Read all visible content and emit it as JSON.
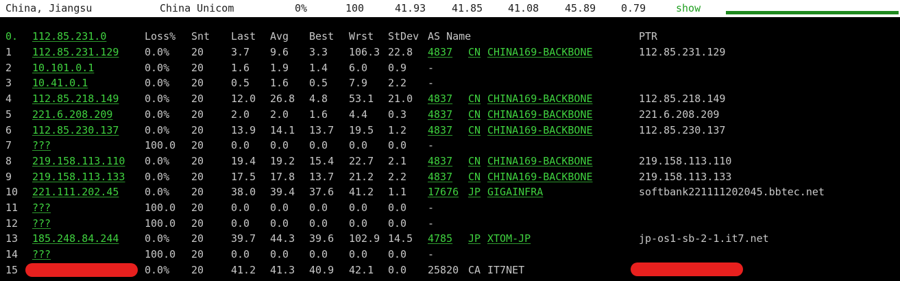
{
  "summary": {
    "location": "China, Jiangsu",
    "isp": "China Unicom",
    "loss": "0%",
    "sent": "100",
    "last": "41.93",
    "avg": "41.85",
    "best": "41.08",
    "worst": "45.89",
    "stdev": "0.79",
    "toggle": "show",
    "accent_color": "#1f8a1f"
  },
  "table": {
    "dest_prefix": "0.",
    "dest_host": "112.85.231.0",
    "headers": {
      "loss": "Loss%",
      "snt": "Snt",
      "last": "Last",
      "avg": "Avg",
      "best": "Best",
      "wrst": "Wrst",
      "stdev": "StDev",
      "as_name": "AS Name",
      "ptr": "PTR"
    },
    "hops": [
      {
        "n": "1",
        "host": "112.85.231.129",
        "loss": "0.0%",
        "snt": "20",
        "last": "3.7",
        "avg": "9.6",
        "best": "3.3",
        "wrst": "106.3",
        "stdev": "22.8",
        "asn": "4837 ",
        "cc": "CN",
        "asname": "CHINA169-BACKBONE",
        "ptr": "112.85.231.129"
      },
      {
        "n": "2",
        "host": "10.101.0.1",
        "loss": "0.0%",
        "snt": "20",
        "last": "1.6",
        "avg": "1.9",
        "best": "1.4",
        "wrst": "6.0",
        "stdev": "0.9",
        "asn": "-",
        "cc": "",
        "asname": "",
        "ptr": ""
      },
      {
        "n": "3",
        "host": "10.41.0.1",
        "loss": "0.0%",
        "snt": "20",
        "last": "0.5",
        "avg": "1.6",
        "best": "0.5",
        "wrst": "7.9",
        "stdev": "2.2",
        "asn": "-",
        "cc": "",
        "asname": "",
        "ptr": ""
      },
      {
        "n": "4",
        "host": "112.85.218.149",
        "loss": "0.0%",
        "snt": "20",
        "last": "12.0",
        "avg": "26.8",
        "best": "4.8",
        "wrst": "53.1",
        "stdev": "21.0",
        "asn": "4837 ",
        "cc": "CN",
        "asname": "CHINA169-BACKBONE",
        "ptr": "112.85.218.149"
      },
      {
        "n": "5",
        "host": "221.6.208.209",
        "loss": "0.0%",
        "snt": "20",
        "last": "2.0",
        "avg": "2.0",
        "best": "1.6",
        "wrst": "4.4",
        "stdev": "0.3",
        "asn": "4837 ",
        "cc": "CN",
        "asname": "CHINA169-BACKBONE",
        "ptr": "221.6.208.209"
      },
      {
        "n": "6",
        "host": "112.85.230.137",
        "loss": "0.0%",
        "snt": "20",
        "last": "13.9",
        "avg": "14.1",
        "best": "13.7",
        "wrst": "19.5",
        "stdev": "1.2",
        "asn": "4837 ",
        "cc": "CN",
        "asname": "CHINA169-BACKBONE",
        "ptr": "112.85.230.137"
      },
      {
        "n": "7",
        "host": "???",
        "loss": "100.0",
        "snt": "20",
        "last": "0.0",
        "avg": "0.0",
        "best": "0.0",
        "wrst": "0.0",
        "stdev": "0.0",
        "asn": "-",
        "cc": "",
        "asname": "",
        "ptr": ""
      },
      {
        "n": "8",
        "host": "219.158.113.110",
        "loss": "0.0%",
        "snt": "20",
        "last": "19.4",
        "avg": "19.2",
        "best": "15.4",
        "wrst": "22.7",
        "stdev": "2.1",
        "asn": "4837 ",
        "cc": "CN",
        "asname": "CHINA169-BACKBONE",
        "ptr": "219.158.113.110"
      },
      {
        "n": "9",
        "host": "219.158.113.133",
        "loss": "0.0%",
        "snt": "20",
        "last": "17.5",
        "avg": "17.8",
        "best": "13.7",
        "wrst": "21.2",
        "stdev": "2.2",
        "asn": "4837 ",
        "cc": "CN",
        "asname": "CHINA169-BACKBONE",
        "ptr": "219.158.113.133"
      },
      {
        "n": "10",
        "host": "221.111.202.45",
        "loss": "0.0%",
        "snt": "20",
        "last": "38.0",
        "avg": "39.4",
        "best": "37.6",
        "wrst": "41.2",
        "stdev": "1.1",
        "asn": "17676",
        "cc": "JP",
        "asname": "GIGAINFRA",
        "ptr": "softbank221111202045.bbtec.net"
      },
      {
        "n": "11",
        "host": "???",
        "loss": "100.0",
        "snt": "20",
        "last": "0.0",
        "avg": "0.0",
        "best": "0.0",
        "wrst": "0.0",
        "stdev": "0.0",
        "asn": "-",
        "cc": "",
        "asname": "",
        "ptr": ""
      },
      {
        "n": "12",
        "host": "???",
        "loss": "100.0",
        "snt": "20",
        "last": "0.0",
        "avg": "0.0",
        "best": "0.0",
        "wrst": "0.0",
        "stdev": "0.0",
        "asn": "-",
        "cc": "",
        "asname": "",
        "ptr": ""
      },
      {
        "n": "13",
        "host": "185.248.84.244",
        "loss": "0.0%",
        "snt": "20",
        "last": "39.7",
        "avg": "44.3",
        "best": "39.6",
        "wrst": "102.9",
        "stdev": "14.5",
        "asn": "4785 ",
        "cc": "JP",
        "asname": "XTOM-JP",
        "ptr": "jp-os1-sb-2-1.it7.net"
      },
      {
        "n": "14",
        "host": "???",
        "loss": "100.0",
        "snt": "20",
        "last": "0.0",
        "avg": "0.0",
        "best": "0.0",
        "wrst": "0.0",
        "stdev": "0.0",
        "asn": "-",
        "cc": "",
        "asname": "",
        "ptr": ""
      },
      {
        "n": "15",
        "host": "",
        "loss": "0.0%",
        "snt": "20",
        "last": "41.2",
        "avg": "41.3",
        "best": "40.9",
        "wrst": "42.1",
        "stdev": "0.0",
        "asn": "25820",
        "cc": "CA",
        "asname": "IT7NET",
        "ptr": "",
        "redacted": true
      }
    ]
  },
  "colors": {
    "background": "#000000",
    "text": "#c8c8c8",
    "link": "#3fd23f",
    "redaction": "#e8201e"
  }
}
